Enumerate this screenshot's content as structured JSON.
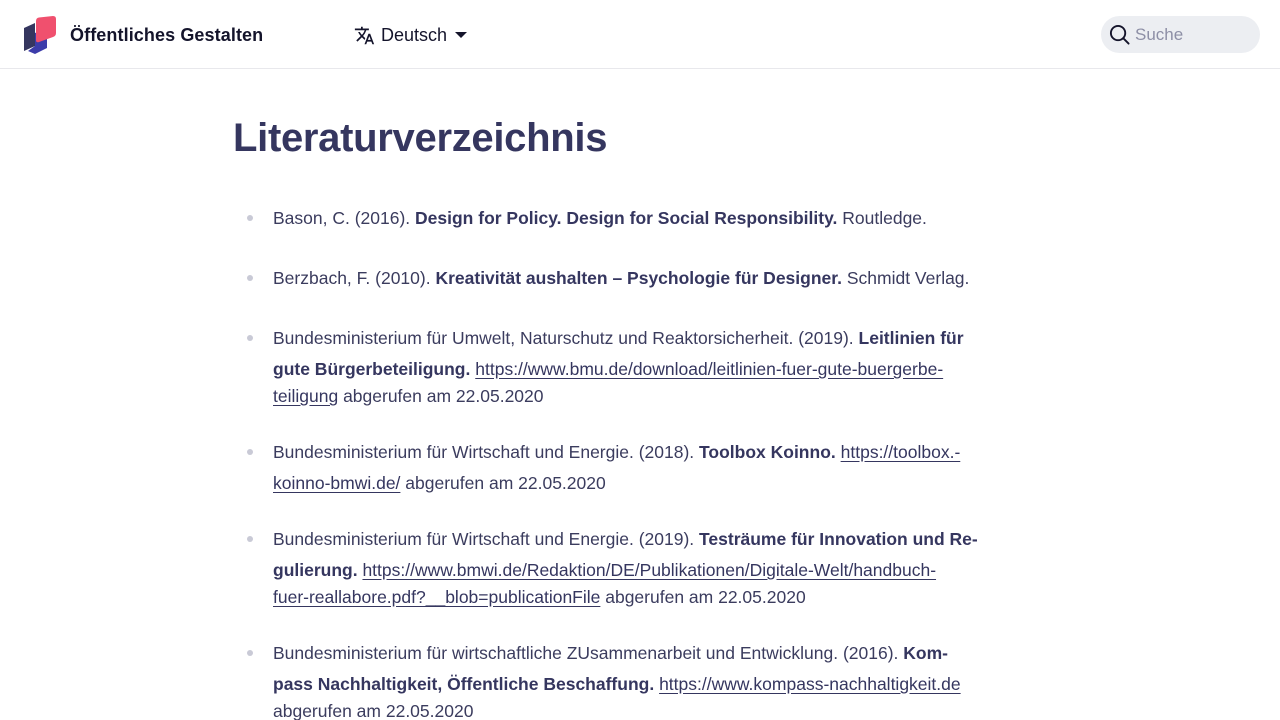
{
  "header": {
    "site_name": "Öffentliches Gestalten",
    "language_label": "Deutsch",
    "search_placeholder": "Suche",
    "brand_colors": {
      "pink": "#f0506e",
      "purple": "#3c3caa",
      "navy": "#35365f"
    },
    "icons": [
      "logo-icon",
      "translate-icon",
      "caret-down-icon",
      "search-icon"
    ]
  },
  "page": {
    "title": "Literaturverzeichnis",
    "references": [
      {
        "lines": [
          {
            "pre": "Bason, C. (2016). ",
            "bold": "Design for Policy. Design for Social Responsibility.",
            "post": " Routledge."
          }
        ]
      },
      {
        "lines": [
          {
            "pre": "Berzbach, F. (2010). ",
            "bold": "Kreativität aushalten – Psychologie für Designer.",
            "post": " Schmidt Verlag."
          }
        ]
      },
      {
        "lines": [
          {
            "pre": "Bundesministerium für Umwelt, Naturschutz und Reaktorsicherheit. (2019). ",
            "bold": "Leitlinien für"
          },
          {
            "bold": "gute Bürgerbeteiligung.",
            "mid": " ",
            "link": "https://www.bmu.de/download/leitlinien-fuer-gute-buergerbe-"
          },
          {
            "link": "teiligung",
            "post": " abgerufen am 22.05.2020"
          }
        ]
      },
      {
        "lines": [
          {
            "pre": "Bundesministerium für Wirtschaft und Energie. (2018). ",
            "bold": "Toolbox Koinno.",
            "mid": " ",
            "link": "https://toolbox.-"
          },
          {
            "link": "koinno-bmwi.de/",
            "post": " abgerufen am 22.05.2020"
          }
        ]
      },
      {
        "lines": [
          {
            "pre": "Bundesministerium für Wirtschaft und Energie. (2019). ",
            "bold": "Testräume für Innovation und Re-"
          },
          {
            "bold": "gulierung.",
            "mid": " ",
            "link": "https://www.bmwi.de/Redaktion/DE/Publikationen/Digitale-Welt/handbuch-"
          },
          {
            "link": "fuer-reallabore.pdf?__blob=publicationFile",
            "post": " abgerufen am 22.05.2020"
          }
        ]
      },
      {
        "lines": [
          {
            "pre": "Bundesministerium für wirtschaftliche ZUsammenarbeit und Entwicklung. (2016). ",
            "bold": "Kom-"
          },
          {
            "bold": "pass Nachhaltigkeit, Öffentliche Beschaffung.",
            "mid": " ",
            "link": "https://www.kompass-nachhaltigkeit.de"
          },
          {
            "post": "abgerufen am 22.05.2020"
          }
        ]
      }
    ]
  }
}
